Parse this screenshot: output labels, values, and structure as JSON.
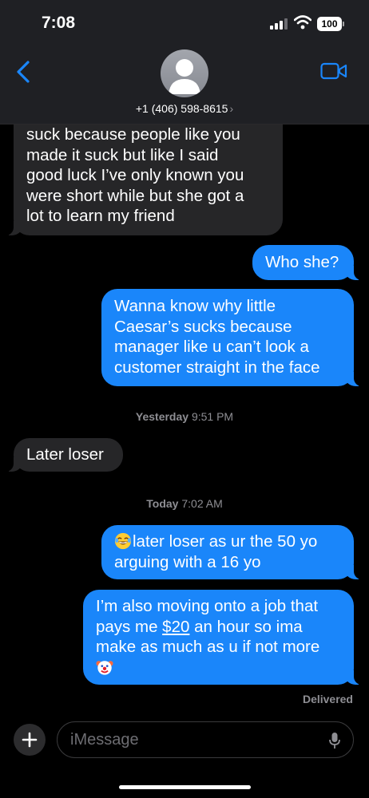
{
  "status_bar": {
    "time": "7:08",
    "battery": "100"
  },
  "header": {
    "contact": "+1 (406) 598-8615",
    "chevron": "›"
  },
  "messages": {
    "m1": {
      "lines": [
        "suck because people like you",
        "made it suck but like I said",
        "good luck I’ve only known you",
        "were short while but she got a",
        "lot to learn my friend"
      ]
    },
    "m2": {
      "text": "Who she?"
    },
    "m3": {
      "lines": [
        "Wanna know why little",
        "Caesar’s sucks because",
        "manager like u can’t look a",
        "customer straight in the face"
      ]
    },
    "ts1": {
      "day": "Yesterday",
      "time": "9:51 PM"
    },
    "m4": {
      "text": "Later loser"
    },
    "ts2": {
      "day": "Today",
      "time": "7:02 AM"
    },
    "m5": {
      "line1": "later loser as ur the 50 yo",
      "line2": "arguing with a 16 yo",
      "emoji": "laughing-crying-emoji"
    },
    "m6": {
      "line1": "I’m also moving onto a job that",
      "line2_pre": "pays me ",
      "line2_link": "$20",
      "line2_post": " an hour so ima",
      "line3": "make as much as u if not more",
      "emoji": "clown-emoji"
    }
  },
  "delivered": "Delivered",
  "input": {
    "placeholder": "iMessage"
  },
  "colors": {
    "outgoing": "#1a86fa",
    "incoming": "#262628",
    "accent": "#1a86fa"
  }
}
